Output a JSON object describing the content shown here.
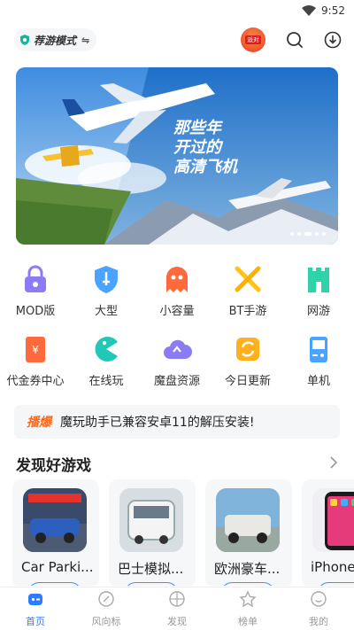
{
  "status_bar": {
    "time": "9:52",
    "icons": [
      "wifi-icon",
      "battery-icon"
    ]
  },
  "header": {
    "mode_label": "荐游模式",
    "mode_swap": "⇋",
    "avatar_tag": "派对",
    "icons": [
      "search-icon",
      "download-icon"
    ]
  },
  "banner": {
    "text_lines": [
      "那些年",
      "开过的",
      "高清飞机"
    ],
    "slide_count": 5,
    "active_slide": 3
  },
  "categories": [
    {
      "label": "MOD版",
      "icon": "lock-icon",
      "color": "#8b7cf6"
    },
    {
      "label": "大型",
      "icon": "shield-sword-icon",
      "color": "#4aa3ff"
    },
    {
      "label": "小容量",
      "icon": "ghost-icon",
      "color": "#ff6a3c"
    },
    {
      "label": "BT手游",
      "icon": "crossed-swords-icon",
      "color": "#ffc21a"
    },
    {
      "label": "网游",
      "icon": "castle-icon",
      "color": "#2ed3a8"
    },
    {
      "label": "代金券中心",
      "icon": "coupon-icon",
      "color": "#ff6a3c"
    },
    {
      "label": "在线玩",
      "icon": "pacman-icon",
      "color": "#22c7b8"
    },
    {
      "label": "魔盘资源",
      "icon": "cloud-upload-icon",
      "color": "#8b7cf6"
    },
    {
      "label": "今日更新",
      "icon": "refresh-icon",
      "color": "#ffb01a"
    },
    {
      "label": "单机",
      "icon": "gamepad-icon",
      "color": "#4aa3ff"
    }
  ],
  "notice": {
    "tag": "播爆",
    "text": "魔玩助手已兼容安卓11的解压安装!"
  },
  "section": {
    "title": "发现好游戏"
  },
  "games": [
    {
      "name": "Car Parki..."
    },
    {
      "name": "巴士模拟..."
    },
    {
      "name": "欧洲豪车..."
    },
    {
      "name": "iPhone"
    }
  ],
  "bottom_nav": [
    {
      "label": "首页",
      "icon": "home-icon",
      "active": true
    },
    {
      "label": "风向标",
      "icon": "compass-icon",
      "active": false
    },
    {
      "label": "发现",
      "icon": "discover-icon",
      "active": false
    },
    {
      "label": "榜单",
      "icon": "ranking-icon",
      "active": false
    },
    {
      "label": "我的",
      "icon": "profile-icon",
      "active": false
    }
  ],
  "colors": {
    "accent": "#2f7bff",
    "notice_tag": "#ff6b1a"
  }
}
